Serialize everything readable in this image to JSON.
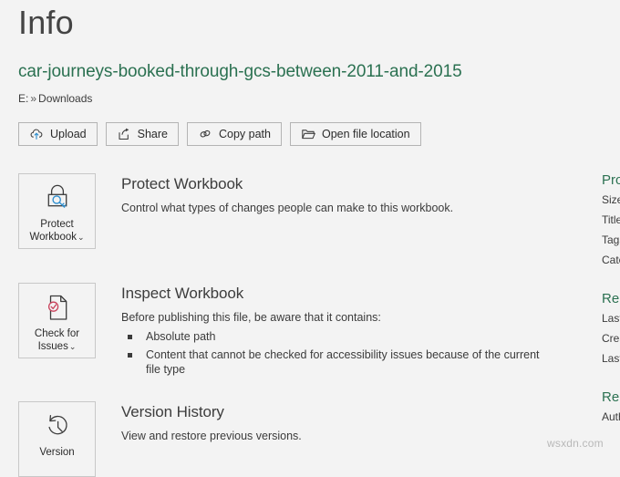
{
  "page": {
    "title": "Info",
    "file_name": "car-journeys-booked-through-gcs-between-2011-and-2015",
    "path_drive": "E:",
    "path_separator": "»",
    "path_folder": "Downloads"
  },
  "colors": {
    "accent_green": "#2b7151",
    "accent_blue": "#2f8fd0",
    "accent_red": "#c9435c",
    "background": "#f3f3f3",
    "text": "#3b3b3b",
    "border": "#b4b4b4"
  },
  "actions": [
    {
      "label": "Upload",
      "icon": "cloud-upload-icon"
    },
    {
      "label": "Share",
      "icon": "share-icon"
    },
    {
      "label": "Copy path",
      "icon": "link-icon"
    },
    {
      "label": "Open file location",
      "icon": "folder-open-icon"
    }
  ],
  "sections": {
    "protect": {
      "tile_label_line1": "Protect",
      "tile_label_line2": "Workbook",
      "tile_caret": "⌄",
      "tile_icon": "lock-key-icon",
      "heading": "Protect Workbook",
      "description": "Control what types of changes people can make to this workbook."
    },
    "inspect": {
      "tile_label_line1": "Check for",
      "tile_label_line2": "Issues",
      "tile_caret": "⌄",
      "tile_icon": "document-check-icon",
      "heading": "Inspect Workbook",
      "description": "Before publishing this file, be aware that it contains:",
      "bullets": [
        "Absolute path",
        "Content that cannot be checked for accessibility issues because of the current file type"
      ]
    },
    "version": {
      "tile_label_line1": "Version",
      "tile_icon": "history-clock-icon",
      "heading": "Version History",
      "description": "View and restore previous versions."
    }
  },
  "properties_panel": {
    "properties_heading": "Pro",
    "properties_items": [
      "Size",
      "Title",
      "Tags",
      "Cate"
    ],
    "dates_heading": "Rel",
    "dates_items": [
      "Last",
      "Crea",
      "Last"
    ],
    "people_heading": "Rel",
    "people_items": [
      "Auth"
    ]
  },
  "watermark": "wsxdn.com"
}
